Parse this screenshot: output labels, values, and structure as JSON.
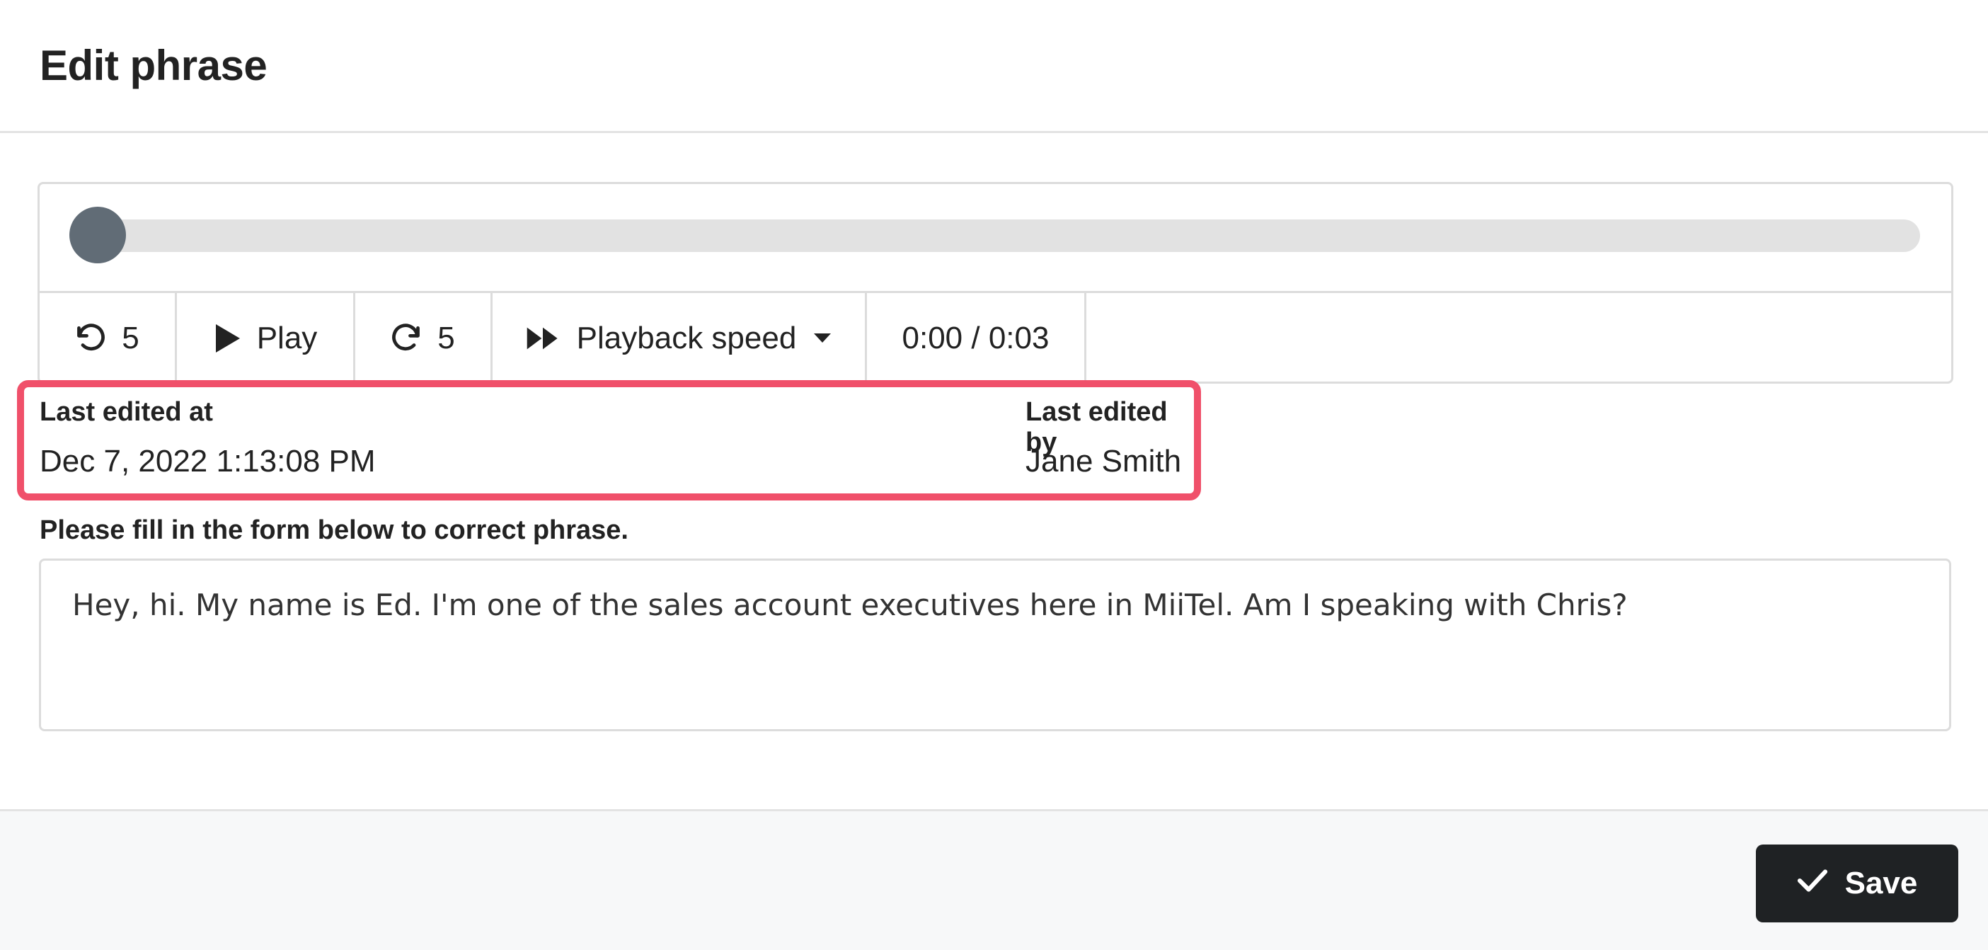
{
  "header": {
    "title": "Edit phrase"
  },
  "player": {
    "progress": 0,
    "rewind_seconds": "5",
    "play_label": "Play",
    "forward_seconds": "5",
    "speed_label": "Playback speed",
    "time_display": "0:00 / 0:03"
  },
  "meta": {
    "last_edited_at_label": "Last edited at",
    "last_edited_at_value": "Dec 7, 2022 1:13:08 PM",
    "last_edited_by_label": "Last edited by",
    "last_edited_by_value": "Jane Smith",
    "highlight_color": "#f0506a"
  },
  "form": {
    "instruction": "Please fill in the form below to correct phrase.",
    "phrase_value": "Hey, hi. My name is Ed. I'm one of the sales account executives here in MiiTel. Am I speaking with Chris?"
  },
  "footer": {
    "save_label": "Save"
  },
  "icons": {
    "rewind": "rotate-ccw-icon",
    "play": "play-icon",
    "forward": "rotate-cw-icon",
    "speed": "fast-forward-icon",
    "dropdown": "caret-down-icon",
    "save": "check-icon"
  }
}
